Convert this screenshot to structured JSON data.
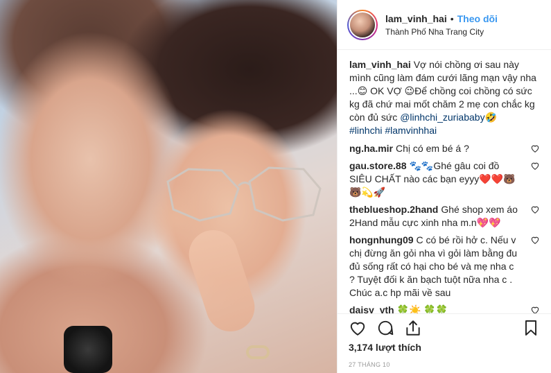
{
  "header": {
    "username": "lam_vinh_hai",
    "separator": "•",
    "follow_label": "Theo dõi",
    "location": "Thành Phố Nha Trang City"
  },
  "caption": {
    "user": "lam_vinh_hai",
    "text": "Vợ nói chồng ơi sau này mình cũng làm đám cưới lãng mạn vậy nha ...😊 OK VỢ 😉Để chồng coi chồng có sức kg đã chứ mai mốt chăm 2 mẹ con chắc kg còn đủ sức ",
    "mention": "@linhchi_zuriababy",
    "after_mention": "🤣",
    "hashtags": [
      "#linhchi",
      "#lamvinhhai"
    ]
  },
  "comments": [
    {
      "user": "ng.ha.mir",
      "text": "Chị có em bé á ?"
    },
    {
      "user": "gau.store.88",
      "text": "🐾🐾Ghé gâu coi đồ SIÊU CHẤT nào các bạn eyyy❤️❤️🐻🐻💫🚀"
    },
    {
      "user": "theblueshop.2hand",
      "text": "Ghé shop xem áo 2Hand mẫu cực xinh nha m.n💖💖"
    },
    {
      "user": "hongnhung09",
      "text": "C có bé rồi hở c. Nếu v chị đừng ăn gỏi nha vì gỏi làm bằng đu đủ sống rất có hại cho bé và mẹ nha c ? Tuyệt đối k ăn bạch tuột nữa nha c . Chúc a.c hp mãi về sau"
    },
    {
      "user": "daisy_yth",
      "text": "🍀☀️ 🍀🍀"
    }
  ],
  "footer": {
    "likes": "3,174 lượt thích",
    "date": "27 THÁNG 10"
  },
  "icons": [
    "heart-icon",
    "comment-icon",
    "share-icon",
    "bookmark-icon"
  ],
  "colors": {
    "accent": "#3897f0",
    "text": "#262626",
    "muted": "#999999",
    "border": "#efefef"
  }
}
